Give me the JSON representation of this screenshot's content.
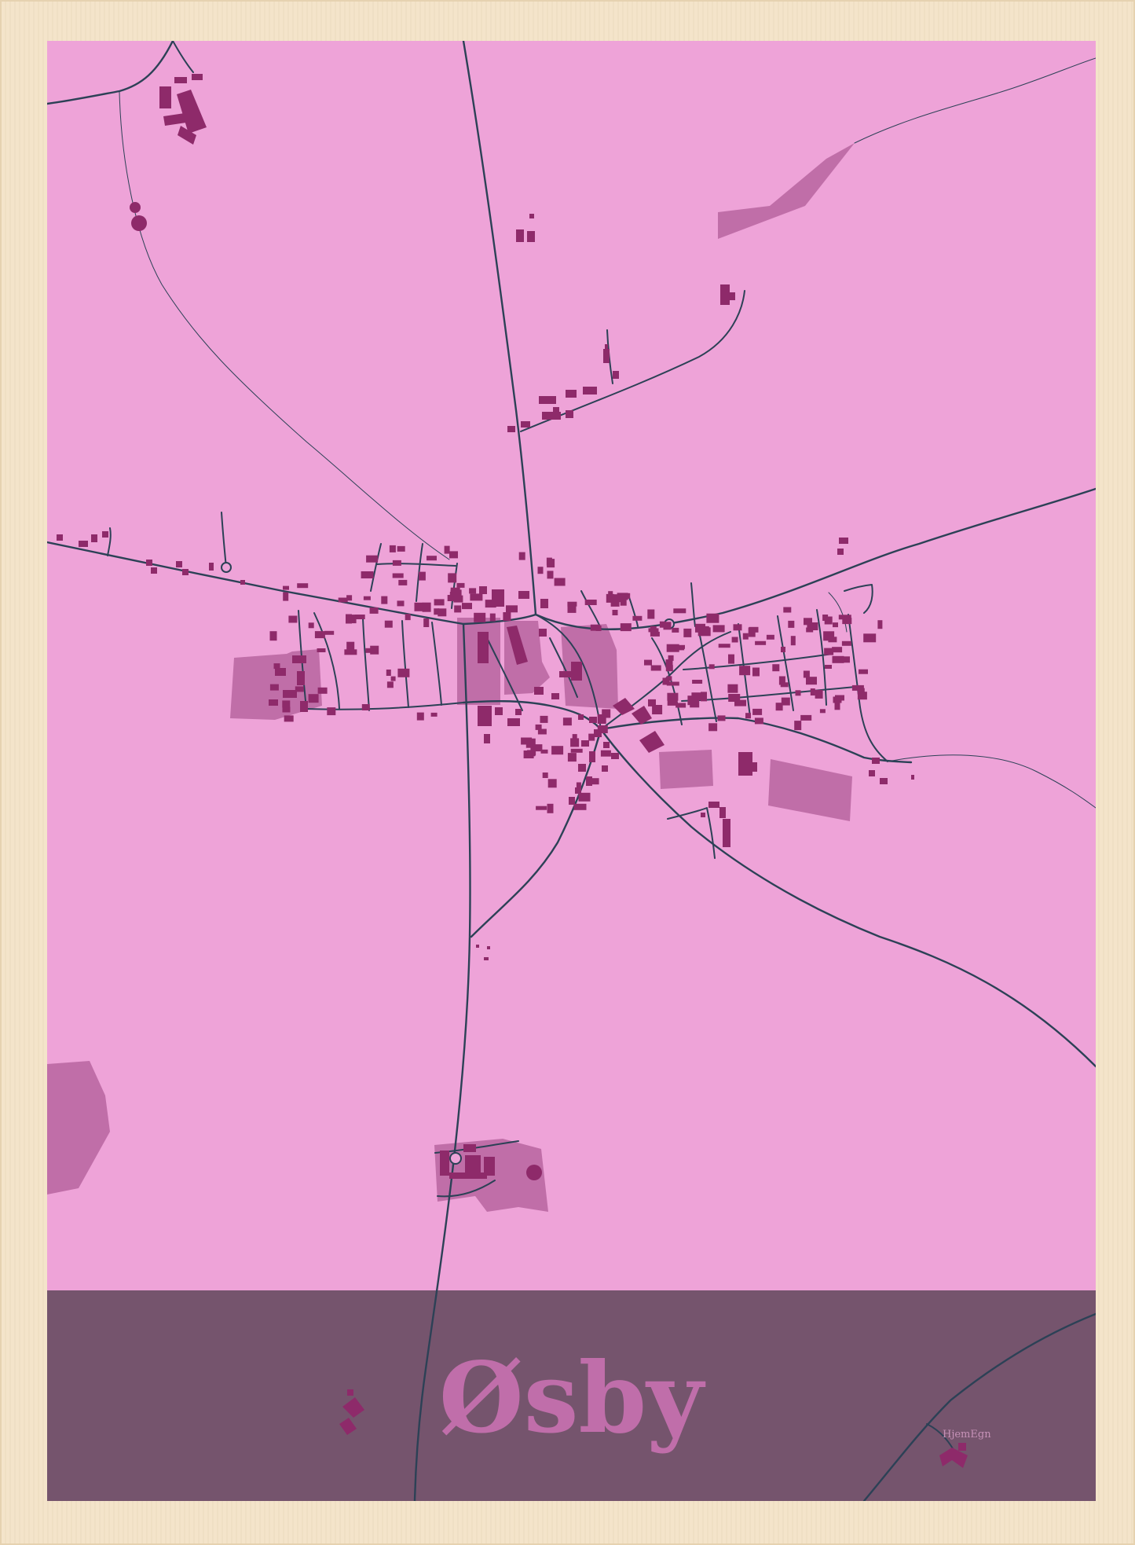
{
  "title": "Øsby",
  "brand": "HjemEgn",
  "colors": {
    "frame": "#f4e3c8",
    "land": "#eea3d8",
    "band": "#75546d",
    "road": "#2c4156",
    "building": "#8e2a6a",
    "area": "#c06ea8",
    "title": "#c06eaa"
  }
}
